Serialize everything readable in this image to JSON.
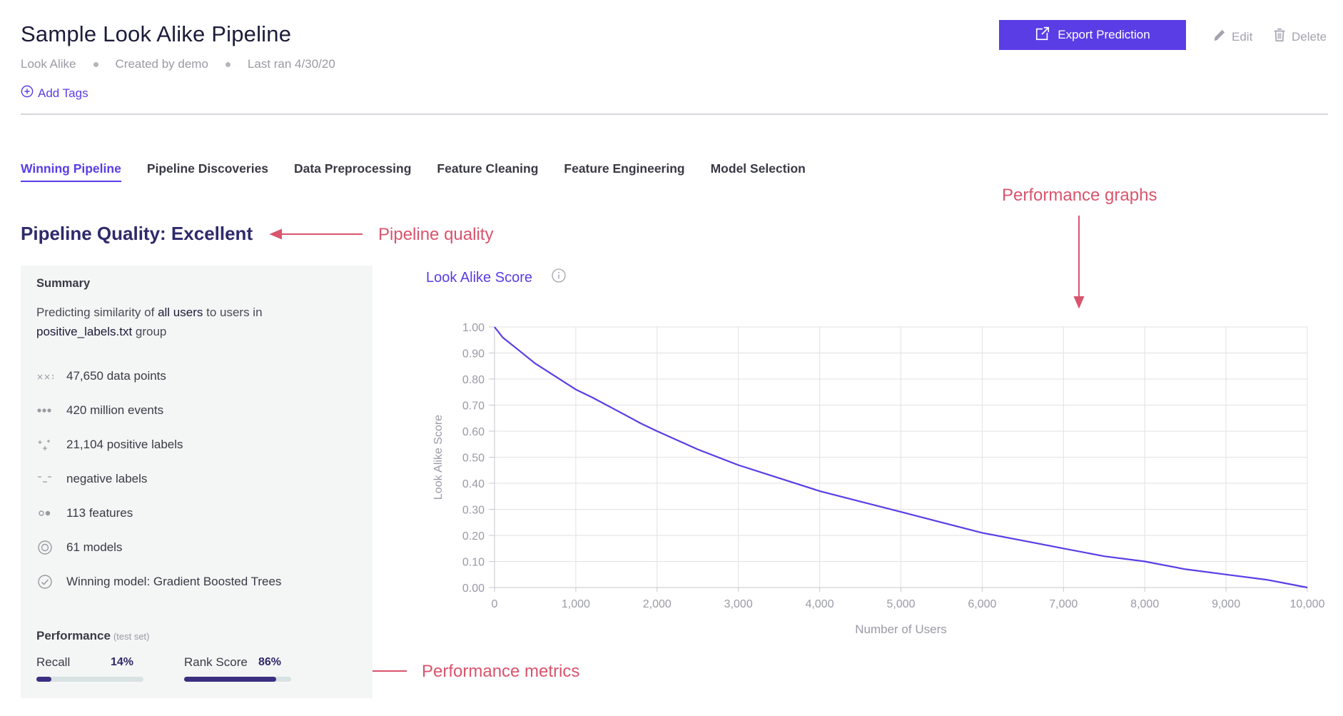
{
  "header": {
    "title": "Sample Look Alike Pipeline",
    "meta": [
      "Look Alike",
      "Created by demo",
      "Last ran 4/30/20"
    ],
    "add_tags": "Add Tags",
    "export_label": "Export Prediction",
    "edit_label": "Edit",
    "delete_label": "Delete",
    "accent_color": "#5b3de6"
  },
  "tabs": [
    {
      "label": "Winning Pipeline",
      "active": true
    },
    {
      "label": "Pipeline Discoveries",
      "active": false
    },
    {
      "label": "Data Preprocessing",
      "active": false
    },
    {
      "label": "Feature Cleaning",
      "active": false
    },
    {
      "label": "Feature Engineering",
      "active": false
    },
    {
      "label": "Model Selection",
      "active": false
    }
  ],
  "quality": "Pipeline Quality: Excellent",
  "annotations": {
    "pipeline_quality": "Pipeline quality",
    "performance_graphs": "Performance graphs",
    "performance_metrics": "Performance metrics",
    "color": "#d9546d"
  },
  "summary": {
    "heading": "Summary",
    "desc_pre": "Predicting similarity of ",
    "desc_strong1": "all users",
    "desc_mid": " to users in",
    "desc_strong2": "positive_labels.txt",
    "desc_post": " group",
    "stats": [
      {
        "icon": "data-points-icon",
        "text": "47,650 data points"
      },
      {
        "icon": "events-icon",
        "text": "420 million events"
      },
      {
        "icon": "positive-labels-icon",
        "text": "21,104 positive labels"
      },
      {
        "icon": "negative-labels-icon",
        "text": "negative labels"
      },
      {
        "icon": "features-icon",
        "text": "113 features"
      },
      {
        "icon": "models-icon",
        "text": "61 models"
      },
      {
        "icon": "check-circle-icon",
        "text": "Winning model: Gradient Boosted Trees"
      }
    ]
  },
  "performance": {
    "heading": "Performance",
    "sub": "(test set)",
    "metrics": [
      {
        "label": "Recall",
        "value": "14%",
        "fraction": 0.14
      },
      {
        "label": "Rank Score",
        "value": "86%",
        "fraction": 0.86
      }
    ]
  },
  "chart_data": {
    "type": "line",
    "title": "Look Alike Score",
    "xlabel": "Number of Users",
    "ylabel": "Look Alike Score",
    "xlim": [
      0,
      10000
    ],
    "ylim": [
      0,
      1
    ],
    "x_ticks": [
      "0",
      "1,000",
      "2,000",
      "3,000",
      "4,000",
      "5,000",
      "6,000",
      "7,000",
      "8,000",
      "9,000",
      "10,000"
    ],
    "y_ticks": [
      "0.00",
      "0.10",
      "0.20",
      "0.30",
      "0.40",
      "0.50",
      "0.60",
      "0.70",
      "0.80",
      "0.90",
      "1.00"
    ],
    "grid": true,
    "line_color": "#5b3de6",
    "series": [
      {
        "x": [
          0,
          100,
          300,
          500,
          700,
          900,
          1000,
          1200,
          1500,
          1800,
          2000,
          2500,
          3000,
          3500,
          4000,
          4500,
          5000,
          5500,
          6000,
          6500,
          7000,
          7500,
          8000,
          8500,
          9000,
          9500,
          10000
        ],
        "values": [
          1.0,
          0.96,
          0.91,
          0.86,
          0.82,
          0.78,
          0.76,
          0.73,
          0.68,
          0.63,
          0.6,
          0.53,
          0.47,
          0.42,
          0.37,
          0.33,
          0.29,
          0.25,
          0.21,
          0.18,
          0.15,
          0.12,
          0.1,
          0.07,
          0.05,
          0.03,
          0.0
        ]
      }
    ]
  }
}
